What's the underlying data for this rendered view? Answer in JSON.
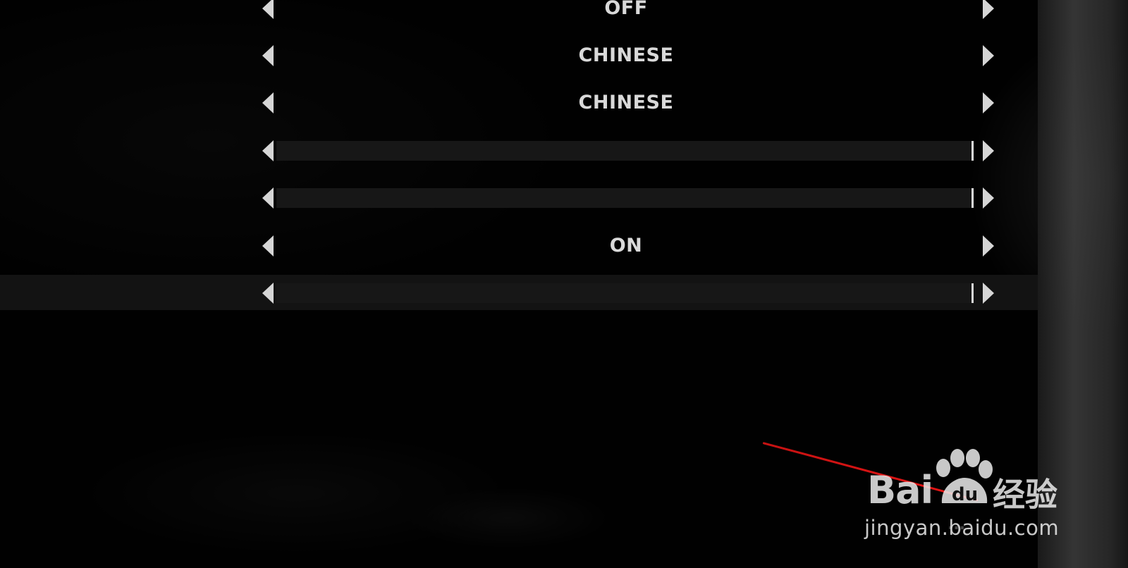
{
  "settings": {
    "rows": [
      {
        "kind": "option",
        "value": "OFF"
      },
      {
        "kind": "option",
        "value": "CHINESE"
      },
      {
        "kind": "option",
        "value": "CHINESE"
      },
      {
        "kind": "slider",
        "level": 1.0
      },
      {
        "kind": "slider",
        "level": 1.0
      },
      {
        "kind": "option",
        "value": "ON"
      },
      {
        "kind": "slider",
        "level": 1.0,
        "selected": true
      }
    ]
  },
  "watermark": {
    "brand": "Bai",
    "paw_text": "du",
    "chinese": "经验",
    "url": "jingyan.baidu.com"
  },
  "footer": {
    "faint_hint": "... "
  },
  "colors": {
    "text": "#d9d9d9",
    "arrow": "#d6d6d6",
    "annotation_line": "#e01414"
  }
}
